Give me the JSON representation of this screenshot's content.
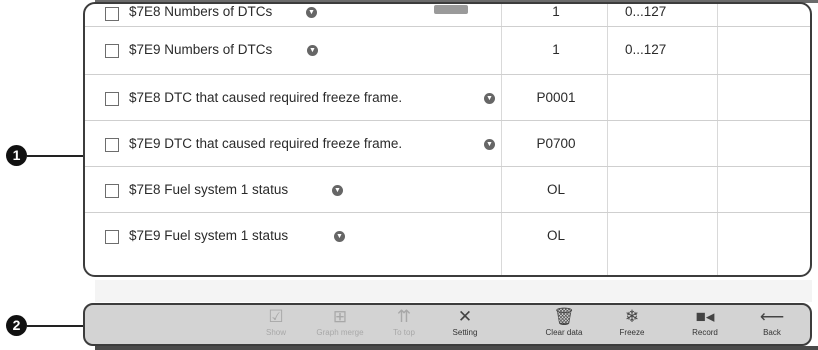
{
  "rows": [
    {
      "name": "$7E8 Numbers of DTCs",
      "value": "1",
      "unit": "0...127"
    },
    {
      "name": "$7E9 Numbers of DTCs",
      "value": "1",
      "unit": "0...127"
    },
    {
      "name": "$7E8 DTC that caused required freeze frame.",
      "value": "P0001",
      "unit": ""
    },
    {
      "name": "$7E9 DTC that caused required freeze frame.",
      "value": "P0700",
      "unit": ""
    },
    {
      "name": "$7E8 Fuel system 1 status",
      "value": "OL",
      "unit": ""
    },
    {
      "name": "$7E9 Fuel system 1 status",
      "value": "OL",
      "unit": ""
    }
  ],
  "callouts": {
    "one": "1",
    "two": "2"
  },
  "toolbar": {
    "show": "Show",
    "graph_merge": "Graph merge",
    "to_top": "To top",
    "setting": "Setting",
    "clear_data": "Clear data",
    "freeze": "Freeze",
    "record": "Record",
    "back": "Back"
  },
  "icons": {
    "show": "checkbox-icon",
    "graph_merge": "graph-merge-icon",
    "to_top": "to-top-icon",
    "setting": "tools-icon",
    "clear_data": "trash-icon",
    "freeze": "snowflake-icon",
    "record": "video-camera-icon",
    "back": "back-arrow-icon",
    "info": "info-icon"
  },
  "colors": {
    "toolbar_bg": "#d3d3d3",
    "frame_border": "#3c3c3c"
  }
}
